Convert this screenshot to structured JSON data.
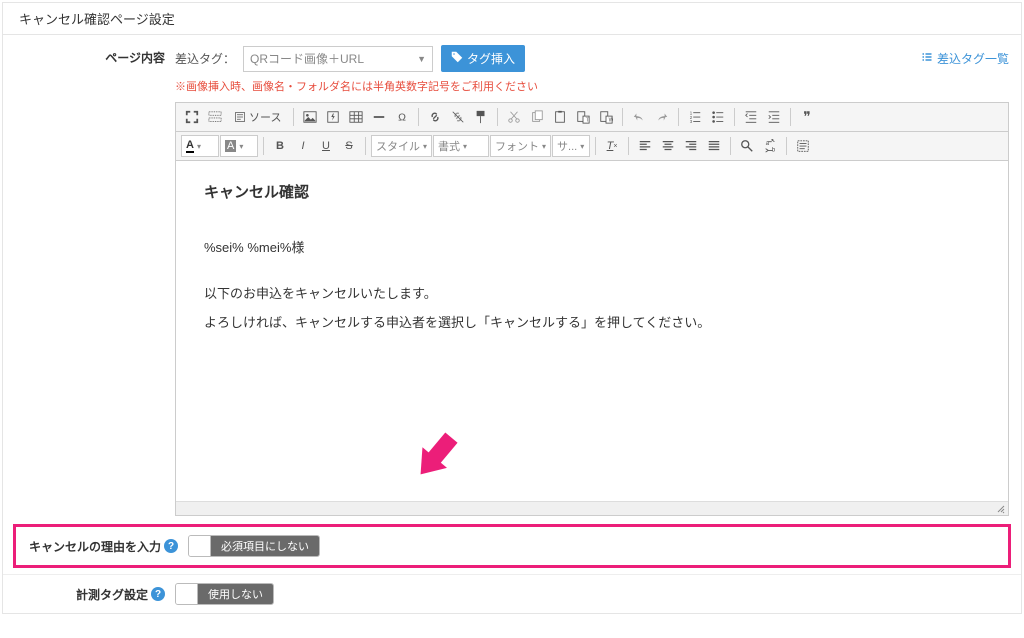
{
  "panel": {
    "title": "キャンセル確認ページ設定"
  },
  "pageContent": {
    "label": "ページ内容",
    "tagLabel": "差込タグ：",
    "tagSelect": "QRコード画像＋URL",
    "insertBtn": "タグ挿入",
    "tagListLink": "差込タグ一覧",
    "warning": "※画像挿入時、画像名・フォルダ名には半角英数字記号をご利用ください"
  },
  "editor": {
    "sourceBtn": "ソース",
    "styleSelect": "スタイル",
    "formatSelect": "書式",
    "fontSelect": "フォント",
    "sizeSelect": "サ...",
    "content": {
      "title": "キャンセル確認",
      "vars": "%sei% %mei%様",
      "line1": "以下のお申込をキャンセルいたします。",
      "line2": "よろしければ、キャンセルする申込者を選択し「キャンセルする」を押してください。"
    }
  },
  "cancelReason": {
    "label": "キャンセルの理由を入力",
    "toggleLabel": "必須項目にしない"
  },
  "tracking": {
    "label": "計測タグ設定",
    "toggleLabel": "使用しない"
  }
}
